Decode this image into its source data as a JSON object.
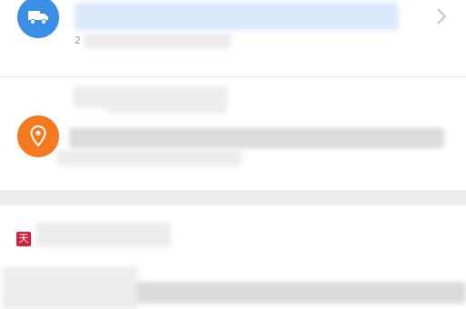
{
  "logistics": {
    "icon": "truck-icon",
    "icon_color": "#3a8ee6",
    "title": "",
    "timestamp": "2",
    "chevron_icon": "chevron-right-icon"
  },
  "address": {
    "icon": "location-pin-icon",
    "icon_color": "#f57a1f",
    "recipient": "",
    "detail": ""
  },
  "store": {
    "badge": "天",
    "badge_color": "#d81e3c",
    "name": ""
  },
  "product": {
    "title": ""
  }
}
